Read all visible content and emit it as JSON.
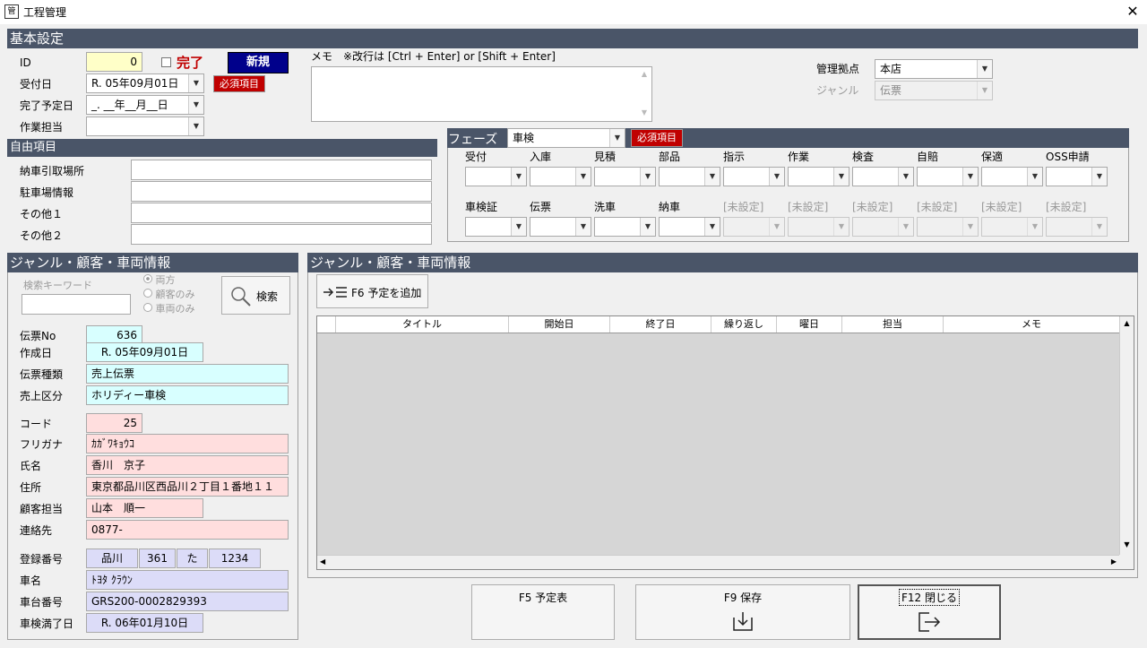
{
  "window": {
    "title": "工程管理",
    "icon_text": "管"
  },
  "basic": {
    "header": "基本設定",
    "id_label": "ID",
    "id_value": "0",
    "done_label": "完了",
    "new_button": "新規",
    "receipt_label": "受付日",
    "receipt_value": "R. 05年09月01日",
    "required_badge": "必須項目",
    "scheduled_label": "完了予定日",
    "scheduled_value": "_. __年__月__日",
    "worker_label": "作業担当",
    "worker_value": "",
    "memo_label": "メモ　※改行は [Ctrl + Enter] or [Shift + Enter]",
    "memo_value": "",
    "branch_label": "管理拠点",
    "branch_value": "本店",
    "genre_label": "ジャンル",
    "genre_value": "伝票"
  },
  "free": {
    "header": "自由項目",
    "items": [
      {
        "label": "納車引取場所",
        "value": ""
      },
      {
        "label": "駐車場情報",
        "value": ""
      },
      {
        "label": "その他１",
        "value": ""
      },
      {
        "label": "その他２",
        "value": ""
      }
    ]
  },
  "phase": {
    "label": "フェーズ",
    "value": "車検",
    "required_badge": "必須項目",
    "row1": [
      "受付",
      "入庫",
      "見積",
      "部品",
      "指示",
      "作業",
      "検査",
      "自賠",
      "保適",
      "OSS申請"
    ],
    "row2": [
      "車検証",
      "伝票",
      "洗車",
      "納車",
      "[未設定]",
      "[未設定]",
      "[未設定]",
      "[未設定]",
      "[未設定]",
      "[未設定]"
    ]
  },
  "customer": {
    "header": "ジャンル・顧客・車両情報",
    "search_label": "検索キーワード",
    "search_value": "",
    "radio_options": [
      "両方",
      "顧客のみ",
      "車両のみ"
    ],
    "search_button": "検索",
    "fields": {
      "slip_no_label": "伝票No",
      "slip_no": "636",
      "created_label": "作成日",
      "created": "R. 05年09月01日",
      "slip_type_label": "伝票種類",
      "slip_type": "売上伝票",
      "sales_class_label": "売上区分",
      "sales_class": "ホリディー車検",
      "code_label": "コード",
      "code": "25",
      "kana_label": "フリガナ",
      "kana": "ｶｶﾞﾜｷｮｳｺ",
      "name_label": "氏名",
      "name": "香川　京子",
      "address_label": "住所",
      "address": "東京都品川区西品川２丁目１番地１１",
      "staff_label": "顧客担当",
      "staff": "山本　順一",
      "contact_label": "連絡先",
      "contact": "0877-",
      "reg_label": "登録番号",
      "reg_area": "品川",
      "reg_class": "361",
      "reg_kana": "た",
      "reg_num": "1234",
      "car_name_label": "車名",
      "car_name": "ﾄﾖﾀ ｸﾗｳﾝ",
      "chassis_label": "車台番号",
      "chassis": "GRS200-0002829393",
      "inspect_label": "車検満了日",
      "inspect": "R. 06年01月10日"
    }
  },
  "schedule": {
    "header": "ジャンル・顧客・車両情報",
    "add_button": "F6 予定を追加",
    "columns": [
      "タイトル",
      "開始日",
      "終了日",
      "繰り返し",
      "曜日",
      "担当",
      "メモ"
    ]
  },
  "footer": {
    "f5": "F5 予定表",
    "f9": "F9 保存",
    "f12": "F12 閉じる"
  }
}
